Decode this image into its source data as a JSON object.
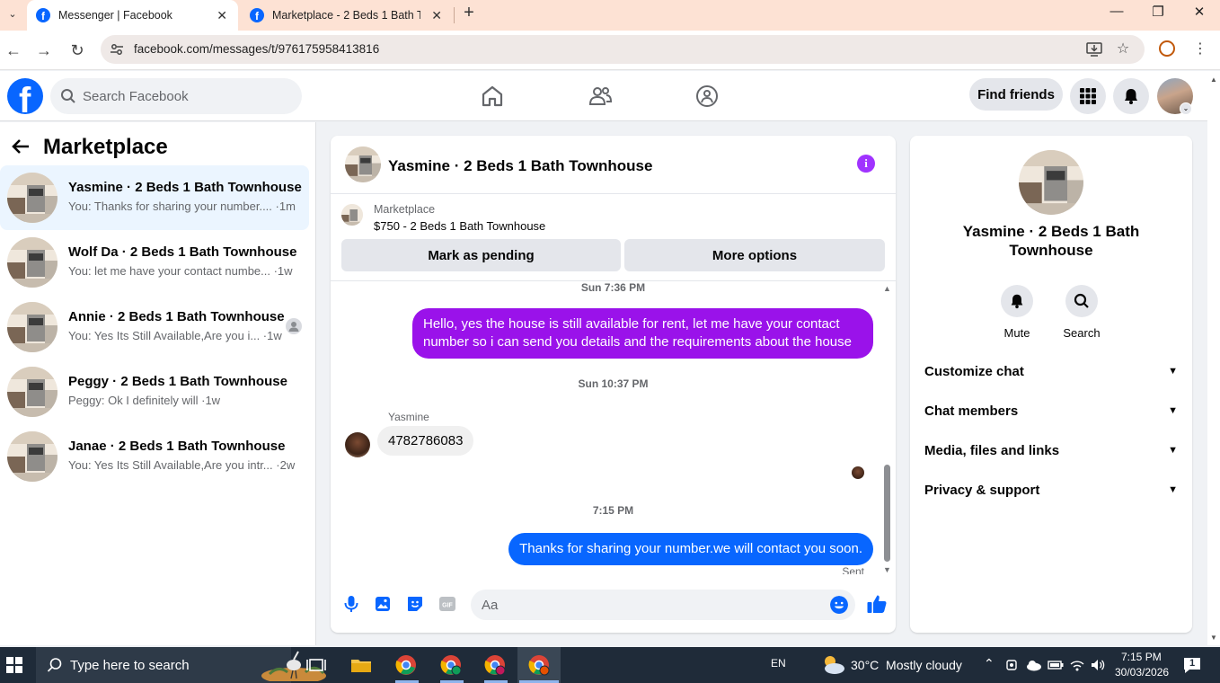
{
  "browser": {
    "tabs": [
      {
        "title": "Messenger | Facebook",
        "active": true
      },
      {
        "title": "Marketplace - 2 Beds 1 Bath Townhouse",
        "active": false
      }
    ],
    "url": "facebook.com/messages/t/976175958413816"
  },
  "header": {
    "search_placeholder": "Search Facebook",
    "find_friends_label": "Find friends"
  },
  "sidebar": {
    "title": "Marketplace",
    "conversations": [
      {
        "name": "Yasmine · 2 Beds 1 Bath Townhouse",
        "snippet": "You: Thanks for sharing your number.... ·1m",
        "selected": true
      },
      {
        "name": "Wolf Da · 2 Beds 1 Bath Townhouse",
        "snippet": "You: let me have your contact numbe... ·1w",
        "selected": false
      },
      {
        "name": "Annie · 2 Beds 1 Bath Townhouse",
        "snippet": "You: Yes Its Still Available,Are you i... ·1w",
        "selected": false
      },
      {
        "name": "Peggy · 2 Beds 1 Bath Townhouse",
        "snippet": "Peggy: Ok I definitely will ·1w",
        "selected": false
      },
      {
        "name": "Janae · 2 Beds 1 Bath Townhouse",
        "snippet": "You: Yes Its Still Available,Are you intr... ·2w",
        "selected": false
      }
    ]
  },
  "chat": {
    "title": "Yasmine · 2 Beds 1 Bath Townhouse",
    "listing_label": "Marketplace",
    "listing_title": "$750 - 2 Beds 1 Bath Townhouse",
    "mark_pending_label": "Mark as pending",
    "more_options_label": "More options",
    "messages": [
      {
        "type": "timestamp",
        "text": "Sun 7:36 PM"
      },
      {
        "type": "outgoing",
        "text": "Hello, yes the house is still available for rent, let me have your contact number so i can send you details and the requirements about the house"
      },
      {
        "type": "timestamp",
        "text": "Sun 10:37 PM"
      },
      {
        "type": "sender",
        "text": "Yasmine"
      },
      {
        "type": "incoming",
        "text": "4782786083"
      },
      {
        "type": "timestamp",
        "text": "7:15 PM"
      },
      {
        "type": "outgoing",
        "text": "Thanks for sharing your number.we will contact you soon."
      },
      {
        "type": "status",
        "text": "Sent"
      }
    ],
    "composer_placeholder": "Aa",
    "colors": {
      "bubble_purple": "#9a12ea",
      "bubble_blue": "#0866ff"
    }
  },
  "info_panel": {
    "name": "Yasmine · 2 Beds 1 Bath Townhouse",
    "actions": [
      {
        "label": "Mute",
        "icon": "bell-icon"
      },
      {
        "label": "Search",
        "icon": "search-icon"
      }
    ],
    "sections": [
      "Customize chat",
      "Chat members",
      "Media, files and links",
      "Privacy & support"
    ]
  },
  "taskbar": {
    "search_placeholder": "Type here to search",
    "language": "EN",
    "weather": "30°C  Mostly cloudy",
    "time": "7:15 PM",
    "date": "30/03/2026",
    "notification_count": "1"
  },
  "theme": {
    "fb_blue": "#0866ff",
    "accent_purple": "#a033ff"
  }
}
